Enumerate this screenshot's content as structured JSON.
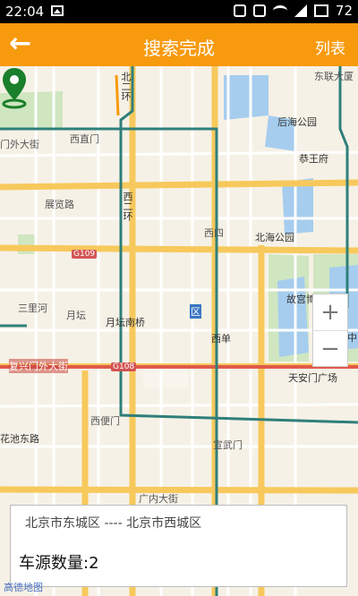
{
  "status_bar": {
    "time": "22:04",
    "battery": "72"
  },
  "app_bar": {
    "back_icon": "←",
    "title": "搜索完成",
    "list_label": "列表"
  },
  "map": {
    "labels": {
      "beierhuan": "北二环",
      "dongsidajie": "东联大厦",
      "xizhimen": "西直门",
      "xizhimen_wai": "门外大街",
      "houhai": "后海公园",
      "gongwangfu": "恭王府",
      "zhanlanlu": "展览路",
      "xisi": "西四",
      "beihai": "北海公园",
      "xierhuan": "西二环",
      "sanlihe": "三里河",
      "yuetan": "月坛",
      "yuetannanqiao": "月坛南桥",
      "gugong": "故宫博物院",
      "xidan": "西单",
      "zhong": "中",
      "fuxingmen": "复兴门外大街",
      "tiananmen": "天安门广场",
      "xibianmen": "西便门",
      "huachi": "花池东路",
      "xuanwumen": "宣武门",
      "guangnei": "广内大街",
      "qu": "区"
    },
    "shields": {
      "g109": "G109",
      "g108": "G108"
    },
    "zoom_in": "+",
    "zoom_out": "−",
    "logo": "高德地图"
  },
  "info_card": {
    "route": "北京市东城区 ---- 北京市西城区",
    "count": "车源数量:2"
  }
}
